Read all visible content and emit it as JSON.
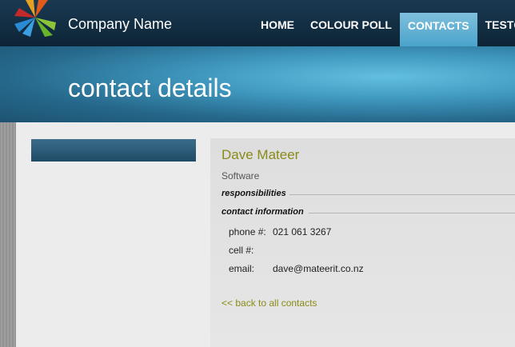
{
  "header": {
    "company_name": "Company Name",
    "nav": [
      {
        "label": "HOME",
        "active": false
      },
      {
        "label": "COLOUR POLL",
        "active": false
      },
      {
        "label": "CONTACTS",
        "active": true
      },
      {
        "label": "TESTCO",
        "active": false
      }
    ]
  },
  "banner": {
    "title": "contact details"
  },
  "contact": {
    "name": "Dave Mateer",
    "department": "Software",
    "responsibilities_heading": "responsibilities",
    "contact_info_heading": "contact information",
    "fields": [
      {
        "label": "phone #:",
        "value": "021 061 3267"
      },
      {
        "label": "cell #:",
        "value": ""
      },
      {
        "label": "email:",
        "value": "dave@mateerit.co.nz"
      }
    ],
    "back_link": "<< back to all contacts"
  },
  "colors": {
    "header_bg": "#0d2436",
    "active_tab": "#4aa3cb",
    "accent_text": "#8a8a1a"
  }
}
